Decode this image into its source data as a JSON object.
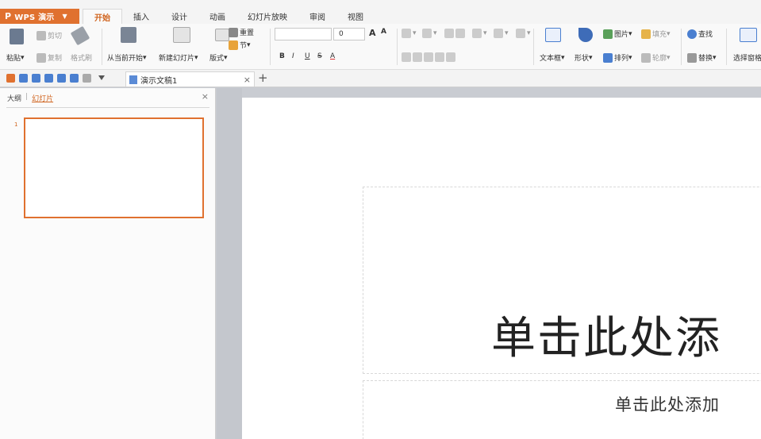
{
  "app": {
    "name": "WPS 演示",
    "logo": "P"
  },
  "menu": {
    "tabs": [
      "开始",
      "插入",
      "设计",
      "动画",
      "幻灯片放映",
      "审阅",
      "视图"
    ],
    "active": "开始"
  },
  "ribbon": {
    "clipboard": {
      "paste": "粘贴",
      "cut": "剪切",
      "copy": "复制",
      "format_painter": "格式刷"
    },
    "slides": {
      "from_current": "从当前开始",
      "new_slide": "新建幻灯片",
      "layout": "版式",
      "reset": "重置",
      "section": "节"
    },
    "font": {
      "size": "0",
      "bold": "B",
      "italic": "I",
      "underline": "U",
      "strike": "S",
      "color": "A",
      "grow": "A",
      "shrink": "A"
    },
    "insert": {
      "textbox": "文本框",
      "shapes": "形状",
      "picture": "图片",
      "arrange": "排列",
      "fill": "填充",
      "outline": "轮廓"
    },
    "edit": {
      "find": "查找",
      "replace": "替换",
      "select_pane": "选择窗格"
    }
  },
  "quickbar": {
    "doc_name": "演示文稿1",
    "close": "×",
    "add": "+"
  },
  "left_panel": {
    "tab_outline": "大纲",
    "tab_slides": "幻灯片",
    "close": "×",
    "slide_number": "1"
  },
  "slide": {
    "title_placeholder": "单击此处添",
    "subtitle_placeholder": "单击此处添加"
  },
  "colors": {
    "accent": "#e0712f",
    "tab_active": "#d0641f"
  }
}
